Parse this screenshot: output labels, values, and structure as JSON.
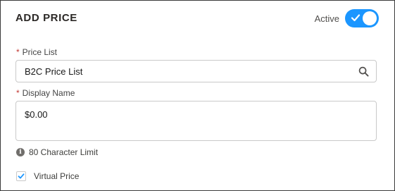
{
  "header": {
    "title": "ADD PRICE",
    "active_label": "Active",
    "active_on": true
  },
  "price_list": {
    "label": "Price List",
    "required_mark": "*",
    "value": "B2C Price List",
    "icon": "search-icon"
  },
  "display_name": {
    "label": "Display Name",
    "required_mark": "*",
    "value": "$0.00"
  },
  "hint": {
    "icon": "info-icon",
    "text": "80 Character Limit"
  },
  "virtual_price": {
    "label": "Virtual Price",
    "checked": true
  },
  "colors": {
    "accent": "#1b96ff",
    "required": "#c23934",
    "border": "#c9c9c9"
  }
}
